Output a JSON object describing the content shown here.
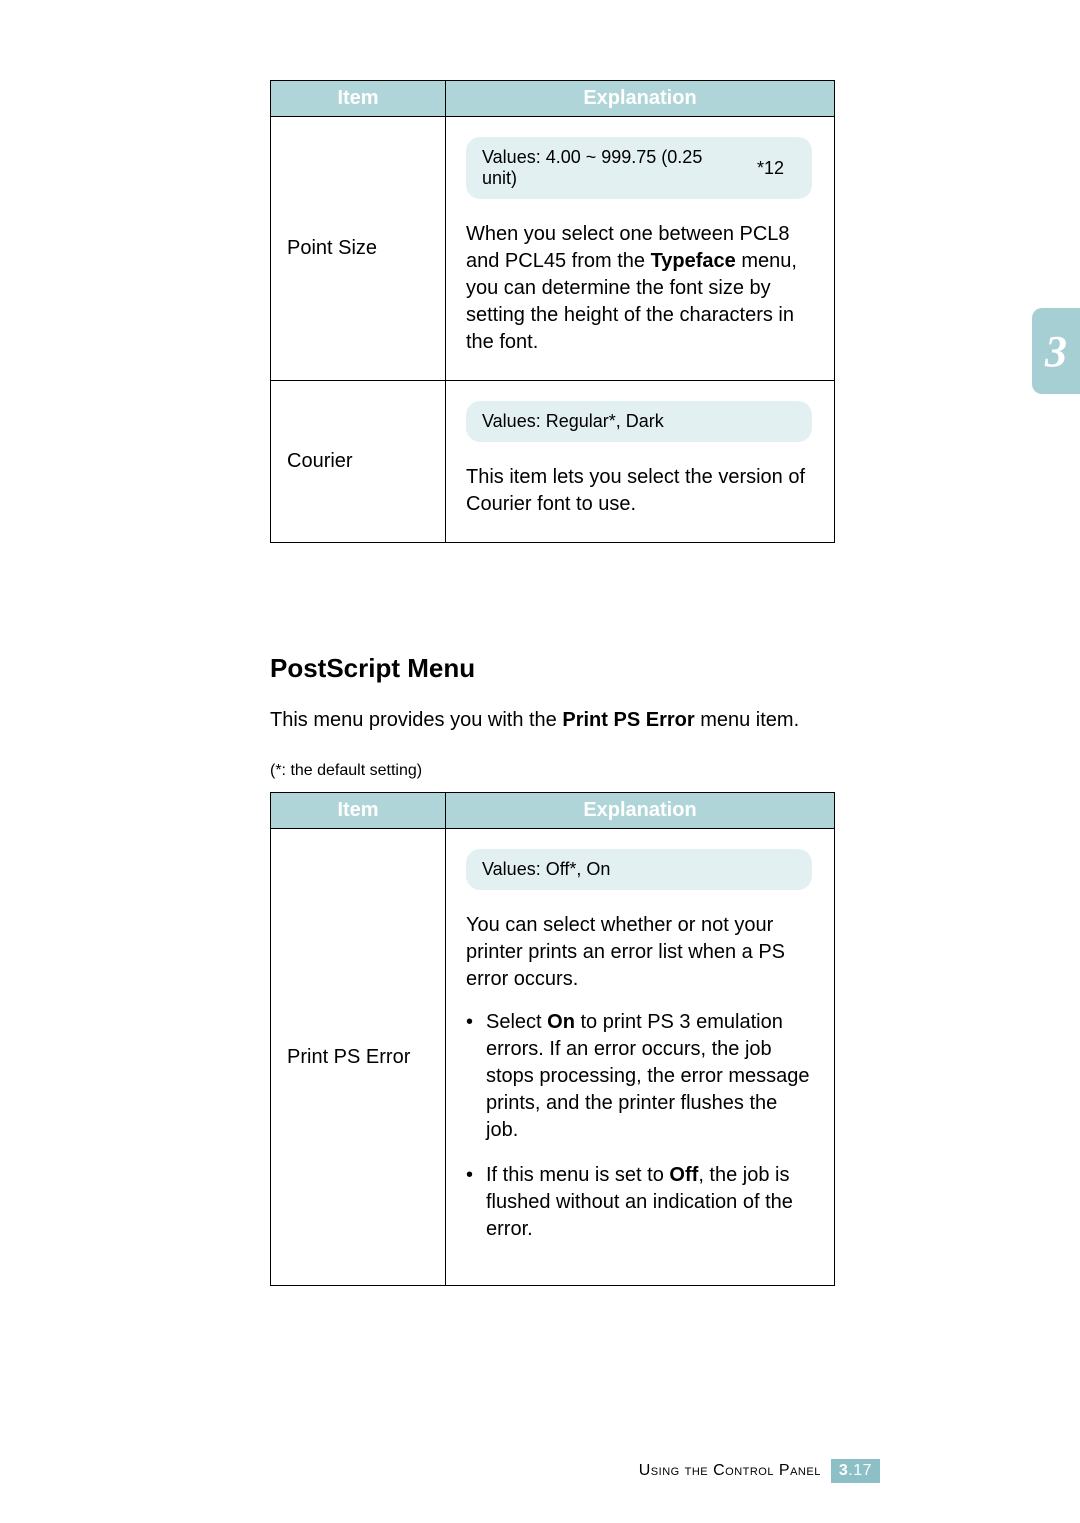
{
  "tables": [
    {
      "headers": {
        "item": "Item",
        "explanation": "Explanation"
      },
      "rows": [
        {
          "item": "Point Size",
          "values_left": "Values: 4.00 ~ 999.75 (0.25 unit)",
          "values_right": "*12",
          "desc_plain_pre": "When you select one between PCL8 and PCL45 from the ",
          "desc_bold": "Typeface",
          "desc_plain_post": " menu, you can determine the font size by setting the height of the characters in the font."
        },
        {
          "item": "Courier",
          "values_left": "Values: Regular*, Dark",
          "values_right": "",
          "desc": "This item lets you select the version of Courier font to use."
        }
      ]
    },
    {
      "headers": {
        "item": "Item",
        "explanation": "Explanation"
      },
      "rows": [
        {
          "item": "Print PS Error",
          "values_left": "Values: Off*, On",
          "values_right": "",
          "desc": "You can select whether or not your printer prints an error list when a PS error occurs.",
          "bullets": [
            {
              "pre": "Select ",
              "bold": "On",
              "post": " to print PS 3 emulation errors. If an error occurs, the job stops processing, the error message prints, and the printer flushes the job."
            },
            {
              "pre": "If this menu is set to ",
              "bold": "Off",
              "post": ", the job is flushed without an indication of the error."
            }
          ]
        }
      ]
    }
  ],
  "section": {
    "heading": "PostScript Menu",
    "intro_pre": "This menu provides you with the ",
    "intro_bold": "Print PS Error",
    "intro_post": " menu item.",
    "default_note": "(*: the default setting)"
  },
  "side_tab": "3",
  "footer": {
    "text": "Using the Control Panel",
    "chapter": "3",
    "page": ".17"
  }
}
